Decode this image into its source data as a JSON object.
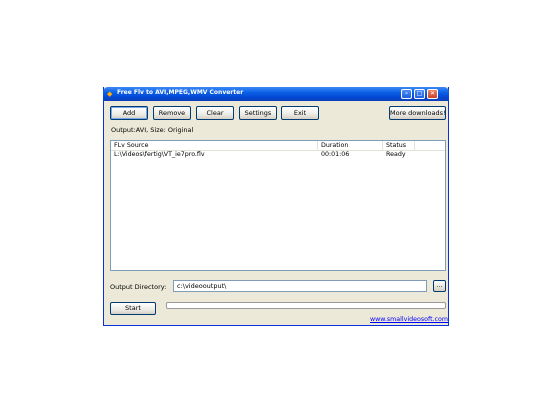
{
  "window": {
    "title": "Free Flv to AVI,MPEG,WMV Converter",
    "controls": {
      "minimize": "–",
      "maximize": "□",
      "close": "✕"
    },
    "app_icon": "app-icon"
  },
  "toolbar": {
    "add": "Add",
    "remove": "Remove",
    "clear": "Clear",
    "settings": "Settings",
    "exit": "Exit",
    "more": "More downloads!"
  },
  "info_line": "Output:AVI, Size: Original",
  "list": {
    "columns": [
      "FLv Source",
      "Duration",
      "Status"
    ],
    "rows": [
      {
        "source": "L:\\Videos\\fertig\\VT_ie7pro.flv",
        "duration": "00:01:06",
        "status": "Ready"
      }
    ]
  },
  "output": {
    "label": "Output Directory:",
    "value": "c:\\videooutput\\",
    "browse": "..."
  },
  "actions": {
    "start": "Start",
    "progress_percent": 0
  },
  "footer_link": "www.smallvideosoft.com",
  "colors": {
    "window_bg": "#ece9d8",
    "titlebar": "#0a5fe5",
    "link": "#0000ff"
  }
}
